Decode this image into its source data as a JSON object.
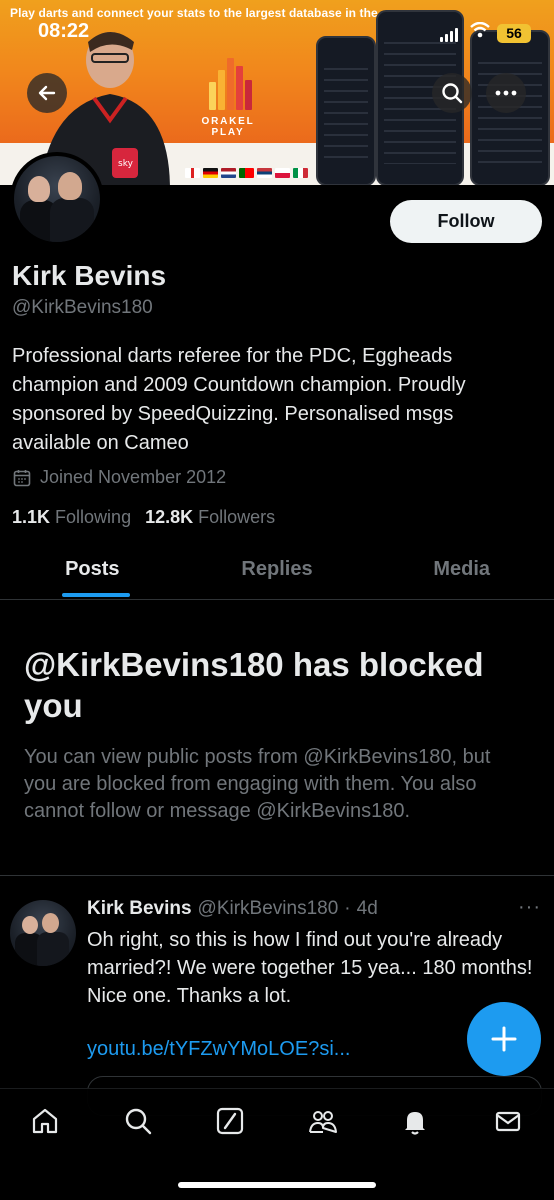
{
  "status_bar": {
    "time": "08:22",
    "battery": "56"
  },
  "banner": {
    "tagline": "Play darts and connect your stats to the largest database in the game",
    "brand": "ORAKEL PLAY"
  },
  "profile": {
    "name": "Kirk Bevins",
    "handle": "@KirkBevins180",
    "bio": "Professional darts referee for the PDC, Eggheads champion and 2009 Countdown champion. Proudly sponsored by SpeedQuizzing. Personalised msgs available on Cameo",
    "joined": "Joined November 2012",
    "following_count": "1.1K",
    "following_label": "Following",
    "followers_count": "12.8K",
    "followers_label": "Followers",
    "follow_label": "Follow"
  },
  "tabs": [
    {
      "label": "Posts",
      "active": true
    },
    {
      "label": "Replies",
      "active": false
    },
    {
      "label": "Media",
      "active": false
    }
  ],
  "blocked": {
    "title": "@KirkBevins180 has blocked you",
    "message": "You can view public posts from @KirkBevins180, but you are blocked from engaging with them. You also cannot follow or message @KirkBevins180."
  },
  "tweet": {
    "author": "Kirk Bevins",
    "handle": "@KirkBevins180",
    "separator": "·",
    "time": "4d",
    "more": "···",
    "text": "Oh right, so this is how I find out you're already married?! We were together 15 yea... 180 months! Nice one. Thanks a lot.",
    "link": "youtu.be/tYFZwYMoLOE?si..."
  },
  "nav": [
    "home-icon",
    "search-icon",
    "grok-icon",
    "communities-icon",
    "notifications-icon",
    "messages-icon"
  ],
  "colors": {
    "accent": "#1d9bf0",
    "background": "#000000",
    "muted": "#71767b",
    "text": "#e7e9ea"
  }
}
